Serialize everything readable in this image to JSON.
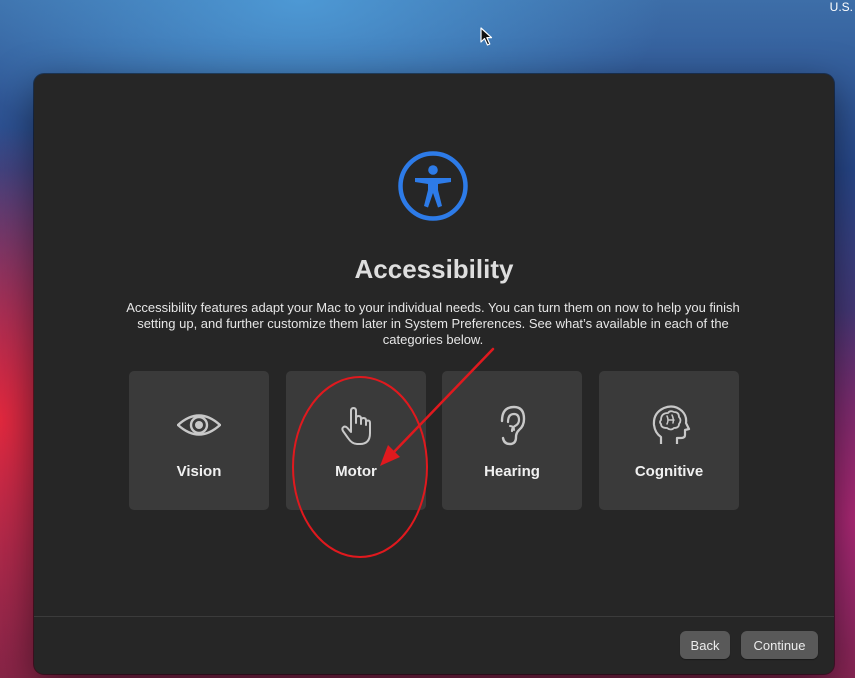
{
  "menubar": {
    "input_source": "U.S."
  },
  "dialog": {
    "icon": "accessibility-icon",
    "title": "Accessibility",
    "description": "Accessibility features adapt your Mac to your individual needs. You can turn them on now to help you finish setting up, and further customize them later in System Preferences. See what’s available in each of the categories below.",
    "categories": [
      {
        "label": "Vision",
        "icon": "eye-icon"
      },
      {
        "label": "Motor",
        "icon": "hand-pointer-icon"
      },
      {
        "label": "Hearing",
        "icon": "ear-icon"
      },
      {
        "label": "Cognitive",
        "icon": "head-brain-icon"
      }
    ],
    "buttons": {
      "back": "Back",
      "continue": "Continue"
    }
  },
  "colors": {
    "accent_blue": "#2d7be8",
    "annotation_red": "#e0191e",
    "window_bg": "#262626",
    "tile_bg": "#3a3a3a"
  },
  "annotation": {
    "type": "red circle and arrow highlighting the Motor category"
  }
}
